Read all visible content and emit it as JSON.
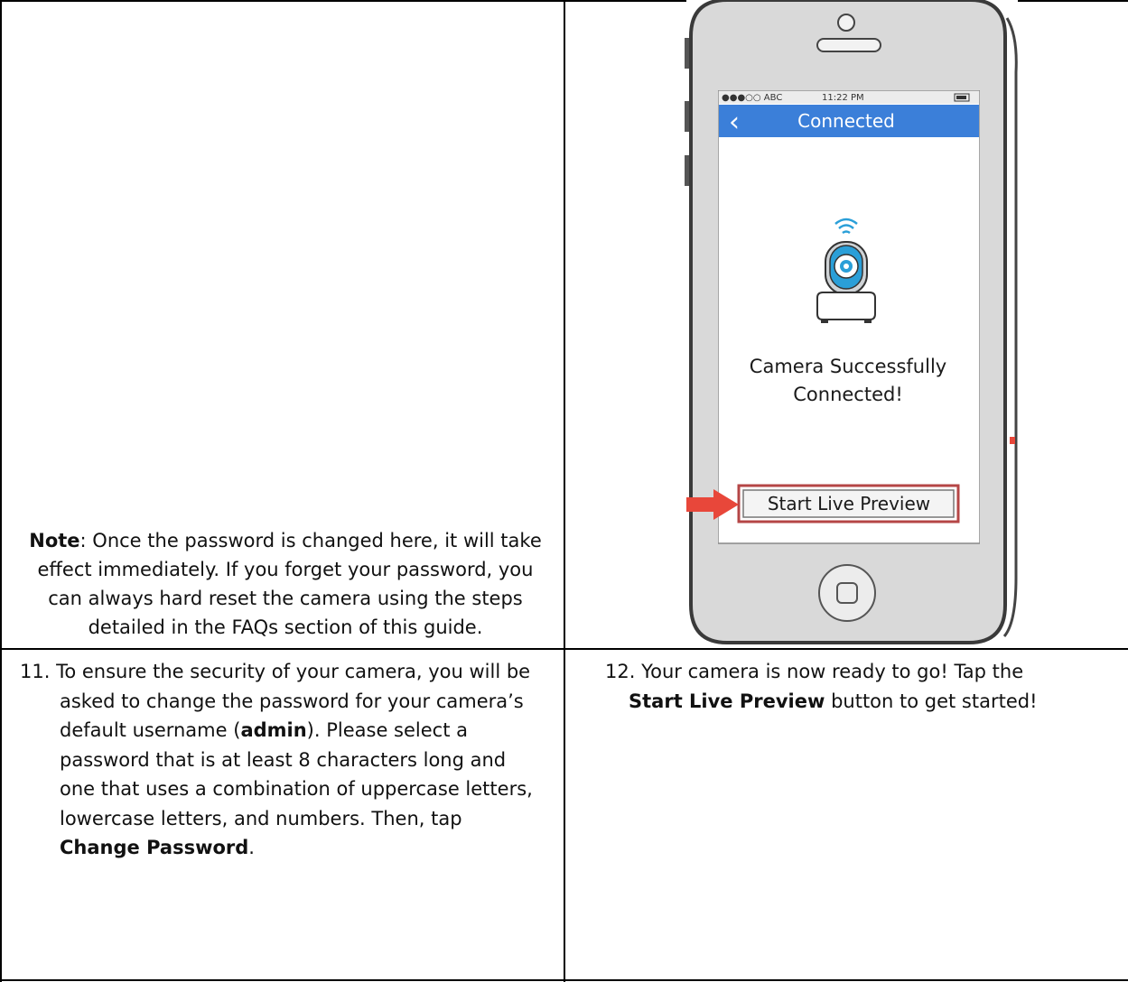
{
  "note": {
    "label": "Note",
    "text": ": Once the password is changed here, it will take effect immediately. If you forget your password, you can always hard reset the camera using the steps detailed in the FAQs section of this guide."
  },
  "step11": {
    "number": "11.",
    "line1": "To ensure the security of your camera, you will be",
    "line2": "asked to change the password for your camera’s",
    "line3_pre": "default username (",
    "line3_bold": "admin",
    "line3_post": "). Please select a",
    "line4": "password that is at least 8 characters long and",
    "line5": "one that uses a combination of uppercase letters,",
    "line6": "lowercase letters, and numbers. Then, tap",
    "line7_bold": "Change Password",
    "line7_post": "."
  },
  "step12": {
    "number": "12.",
    "line1": "Your camera is now ready to go! Tap the",
    "line2_bold": "Start Live Preview",
    "line2_post": " button to get started!"
  },
  "phone": {
    "carrier": "●●●○○ ABC",
    "time": "11:22 PM",
    "nav_title": "Connected",
    "back_glyph": "‹",
    "message_line1": "Camera Successfully",
    "message_line2": "Connected!",
    "button_label": "Start Live Preview",
    "colors": {
      "nav_bar": "#3b7fd9",
      "camera_blue": "#2a9fd8",
      "highlight": "#b54646",
      "arrow": "#e8473a"
    }
  }
}
